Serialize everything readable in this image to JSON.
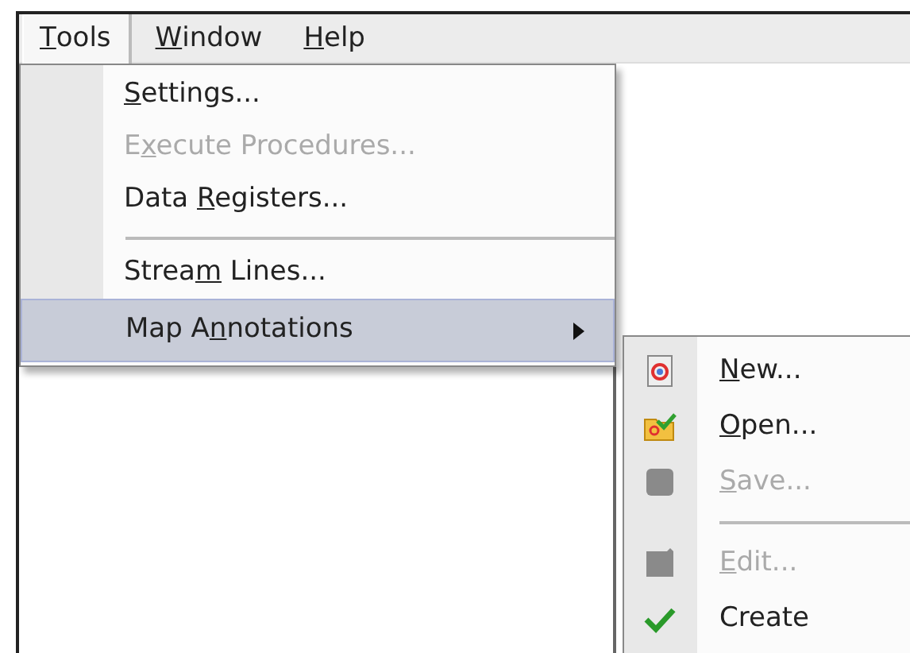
{
  "menu_bar": [
    {
      "key": "T",
      "post": "ools",
      "selected": true
    },
    {
      "key": "W",
      "post": "indow",
      "selected": false
    },
    {
      "key": "H",
      "post": "elp",
      "selected": false
    }
  ],
  "tools_menu": [
    {
      "kind": "item",
      "key": "S",
      "post": "ettings...",
      "disabled": false,
      "selected": false,
      "submenu": false
    },
    {
      "kind": "item",
      "pre": "E",
      "key": "x",
      "post": "ecute Procedures...",
      "disabled": true,
      "selected": false,
      "submenu": false
    },
    {
      "kind": "item",
      "pre": "Data ",
      "key": "R",
      "post": "egisters...",
      "disabled": false,
      "selected": false,
      "submenu": false
    },
    {
      "kind": "separator"
    },
    {
      "kind": "item",
      "pre": "Strea",
      "key": "m",
      "post": " Lines...",
      "disabled": false,
      "selected": false,
      "submenu": false
    },
    {
      "kind": "item",
      "pre": "Map A",
      "key": "n",
      "post": "notations",
      "disabled": false,
      "selected": true,
      "submenu": true
    }
  ],
  "annotations_submenu": [
    {
      "kind": "item",
      "key": "N",
      "post": "ew...",
      "disabled": false
    },
    {
      "kind": "item",
      "key": "O",
      "post": "pen...",
      "disabled": false
    },
    {
      "kind": "item",
      "key": "S",
      "post": "ave...",
      "disabled": true
    },
    {
      "kind": "separator"
    },
    {
      "kind": "item",
      "key": "E",
      "post": "dit...",
      "disabled": true
    },
    {
      "kind": "item",
      "post": "Create",
      "disabled": false
    }
  ]
}
